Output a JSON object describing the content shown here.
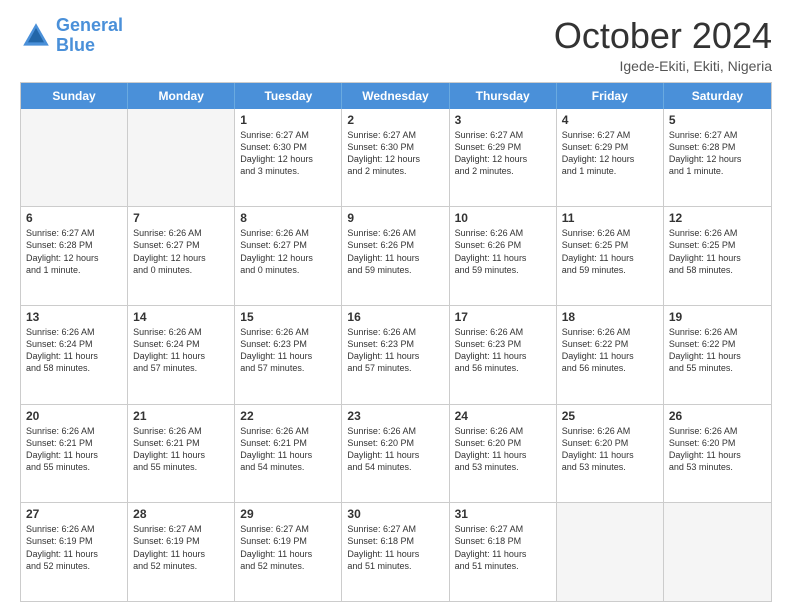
{
  "header": {
    "logo_general": "General",
    "logo_blue": "Blue",
    "title": "October 2024",
    "subtitle": "Igede-Ekiti, Ekiti, Nigeria"
  },
  "days": [
    "Sunday",
    "Monday",
    "Tuesday",
    "Wednesday",
    "Thursday",
    "Friday",
    "Saturday"
  ],
  "rows": [
    [
      {
        "day": "",
        "lines": []
      },
      {
        "day": "",
        "lines": []
      },
      {
        "day": "1",
        "lines": [
          "Sunrise: 6:27 AM",
          "Sunset: 6:30 PM",
          "Daylight: 12 hours",
          "and 3 minutes."
        ]
      },
      {
        "day": "2",
        "lines": [
          "Sunrise: 6:27 AM",
          "Sunset: 6:30 PM",
          "Daylight: 12 hours",
          "and 2 minutes."
        ]
      },
      {
        "day": "3",
        "lines": [
          "Sunrise: 6:27 AM",
          "Sunset: 6:29 PM",
          "Daylight: 12 hours",
          "and 2 minutes."
        ]
      },
      {
        "day": "4",
        "lines": [
          "Sunrise: 6:27 AM",
          "Sunset: 6:29 PM",
          "Daylight: 12 hours",
          "and 1 minute."
        ]
      },
      {
        "day": "5",
        "lines": [
          "Sunrise: 6:27 AM",
          "Sunset: 6:28 PM",
          "Daylight: 12 hours",
          "and 1 minute."
        ]
      }
    ],
    [
      {
        "day": "6",
        "lines": [
          "Sunrise: 6:27 AM",
          "Sunset: 6:28 PM",
          "Daylight: 12 hours",
          "and 1 minute."
        ]
      },
      {
        "day": "7",
        "lines": [
          "Sunrise: 6:26 AM",
          "Sunset: 6:27 PM",
          "Daylight: 12 hours",
          "and 0 minutes."
        ]
      },
      {
        "day": "8",
        "lines": [
          "Sunrise: 6:26 AM",
          "Sunset: 6:27 PM",
          "Daylight: 12 hours",
          "and 0 minutes."
        ]
      },
      {
        "day": "9",
        "lines": [
          "Sunrise: 6:26 AM",
          "Sunset: 6:26 PM",
          "Daylight: 11 hours",
          "and 59 minutes."
        ]
      },
      {
        "day": "10",
        "lines": [
          "Sunrise: 6:26 AM",
          "Sunset: 6:26 PM",
          "Daylight: 11 hours",
          "and 59 minutes."
        ]
      },
      {
        "day": "11",
        "lines": [
          "Sunrise: 6:26 AM",
          "Sunset: 6:25 PM",
          "Daylight: 11 hours",
          "and 59 minutes."
        ]
      },
      {
        "day": "12",
        "lines": [
          "Sunrise: 6:26 AM",
          "Sunset: 6:25 PM",
          "Daylight: 11 hours",
          "and 58 minutes."
        ]
      }
    ],
    [
      {
        "day": "13",
        "lines": [
          "Sunrise: 6:26 AM",
          "Sunset: 6:24 PM",
          "Daylight: 11 hours",
          "and 58 minutes."
        ]
      },
      {
        "day": "14",
        "lines": [
          "Sunrise: 6:26 AM",
          "Sunset: 6:24 PM",
          "Daylight: 11 hours",
          "and 57 minutes."
        ]
      },
      {
        "day": "15",
        "lines": [
          "Sunrise: 6:26 AM",
          "Sunset: 6:23 PM",
          "Daylight: 11 hours",
          "and 57 minutes."
        ]
      },
      {
        "day": "16",
        "lines": [
          "Sunrise: 6:26 AM",
          "Sunset: 6:23 PM",
          "Daylight: 11 hours",
          "and 57 minutes."
        ]
      },
      {
        "day": "17",
        "lines": [
          "Sunrise: 6:26 AM",
          "Sunset: 6:23 PM",
          "Daylight: 11 hours",
          "and 56 minutes."
        ]
      },
      {
        "day": "18",
        "lines": [
          "Sunrise: 6:26 AM",
          "Sunset: 6:22 PM",
          "Daylight: 11 hours",
          "and 56 minutes."
        ]
      },
      {
        "day": "19",
        "lines": [
          "Sunrise: 6:26 AM",
          "Sunset: 6:22 PM",
          "Daylight: 11 hours",
          "and 55 minutes."
        ]
      }
    ],
    [
      {
        "day": "20",
        "lines": [
          "Sunrise: 6:26 AM",
          "Sunset: 6:21 PM",
          "Daylight: 11 hours",
          "and 55 minutes."
        ]
      },
      {
        "day": "21",
        "lines": [
          "Sunrise: 6:26 AM",
          "Sunset: 6:21 PM",
          "Daylight: 11 hours",
          "and 55 minutes."
        ]
      },
      {
        "day": "22",
        "lines": [
          "Sunrise: 6:26 AM",
          "Sunset: 6:21 PM",
          "Daylight: 11 hours",
          "and 54 minutes."
        ]
      },
      {
        "day": "23",
        "lines": [
          "Sunrise: 6:26 AM",
          "Sunset: 6:20 PM",
          "Daylight: 11 hours",
          "and 54 minutes."
        ]
      },
      {
        "day": "24",
        "lines": [
          "Sunrise: 6:26 AM",
          "Sunset: 6:20 PM",
          "Daylight: 11 hours",
          "and 53 minutes."
        ]
      },
      {
        "day": "25",
        "lines": [
          "Sunrise: 6:26 AM",
          "Sunset: 6:20 PM",
          "Daylight: 11 hours",
          "and 53 minutes."
        ]
      },
      {
        "day": "26",
        "lines": [
          "Sunrise: 6:26 AM",
          "Sunset: 6:20 PM",
          "Daylight: 11 hours",
          "and 53 minutes."
        ]
      }
    ],
    [
      {
        "day": "27",
        "lines": [
          "Sunrise: 6:26 AM",
          "Sunset: 6:19 PM",
          "Daylight: 11 hours",
          "and 52 minutes."
        ]
      },
      {
        "day": "28",
        "lines": [
          "Sunrise: 6:27 AM",
          "Sunset: 6:19 PM",
          "Daylight: 11 hours",
          "and 52 minutes."
        ]
      },
      {
        "day": "29",
        "lines": [
          "Sunrise: 6:27 AM",
          "Sunset: 6:19 PM",
          "Daylight: 11 hours",
          "and 52 minutes."
        ]
      },
      {
        "day": "30",
        "lines": [
          "Sunrise: 6:27 AM",
          "Sunset: 6:18 PM",
          "Daylight: 11 hours",
          "and 51 minutes."
        ]
      },
      {
        "day": "31",
        "lines": [
          "Sunrise: 6:27 AM",
          "Sunset: 6:18 PM",
          "Daylight: 11 hours",
          "and 51 minutes."
        ]
      },
      {
        "day": "",
        "lines": []
      },
      {
        "day": "",
        "lines": []
      }
    ]
  ]
}
